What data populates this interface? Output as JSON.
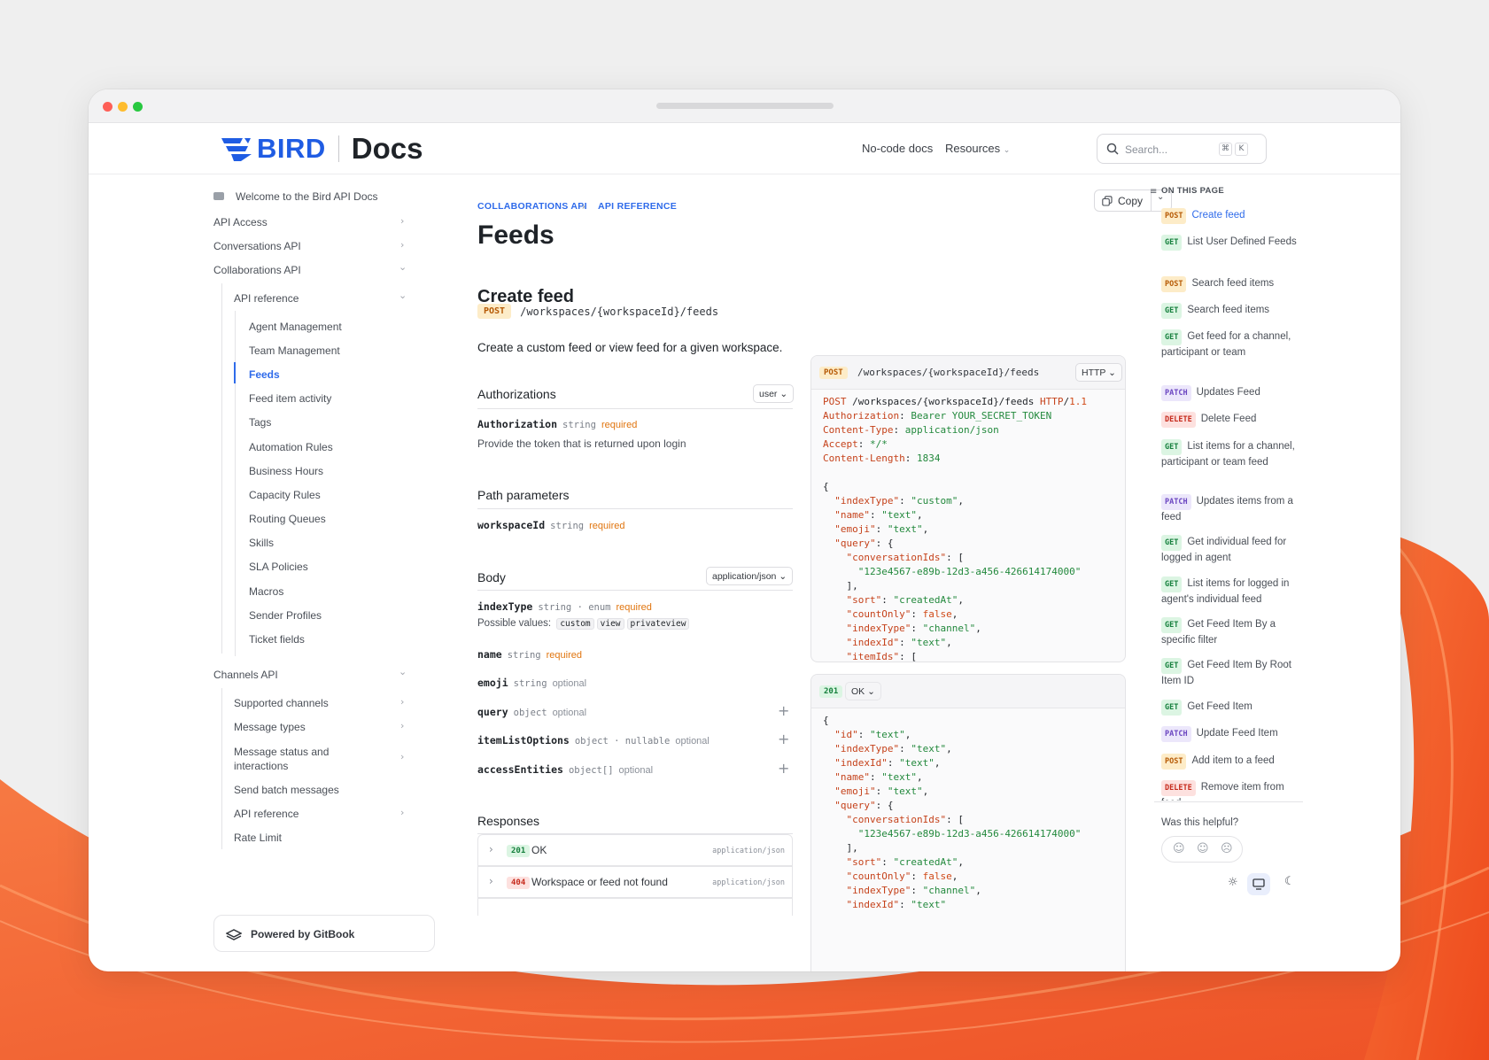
{
  "header": {
    "logo_text": "BIRD",
    "logo_sub": "Docs",
    "nav": [
      "No-code docs",
      "Resources"
    ],
    "search_placeholder": "Search...",
    "shortcut": [
      "⌘",
      "K"
    ]
  },
  "sidebar": {
    "welcome": "Welcome to the Bird API Docs",
    "top": [
      "API Access",
      "Conversations API",
      "Collaborations API"
    ],
    "api_reference": "API reference",
    "collab_items": [
      "Agent Management",
      "Team Management",
      "Feeds",
      "Feed item activity",
      "Tags",
      "Automation Rules",
      "Business Hours",
      "Capacity Rules",
      "Routing Queues",
      "Skills",
      "SLA Policies",
      "Macros",
      "Sender Profiles",
      "Ticket fields"
    ],
    "active_item": "Feeds",
    "channels": "Channels API",
    "channel_items": [
      "Supported channels",
      "Message types",
      "Message status and interactions",
      "Send batch messages",
      "API reference",
      "Rate Limit"
    ],
    "powered_by": "Powered by GitBook"
  },
  "main": {
    "breadcrumb": [
      "COLLABORATIONS API",
      "API REFERENCE"
    ],
    "title": "Feeds",
    "copy_label": "Copy",
    "section_title": "Create feed",
    "method": "POST",
    "path": "/workspaces/{workspaceId}/feeds",
    "description": "Create a custom feed or view feed for a given workspace.",
    "authorizations": {
      "heading": "Authorizations",
      "select": "user",
      "param": "Authorization",
      "type": "string",
      "flag": "required",
      "desc": "Provide the token that is returned upon login"
    },
    "path_params": {
      "heading": "Path parameters",
      "param": "workspaceId",
      "type": "string",
      "flag": "required"
    },
    "body": {
      "heading": "Body",
      "select": "application/json",
      "params": [
        {
          "name": "indexType",
          "type": "string · enum",
          "flag": "required"
        },
        {
          "name": "name",
          "type": "string",
          "flag": "required"
        },
        {
          "name": "emoji",
          "type": "string",
          "flag": "optional"
        },
        {
          "name": "query",
          "type": "object",
          "flag": "optional"
        },
        {
          "name": "itemListOptions",
          "type": "object · nullable",
          "flag": "optional"
        },
        {
          "name": "accessEntities",
          "type": "object[]",
          "flag": "optional"
        }
      ],
      "possible_values_label": "Possible values:",
      "possible_values": [
        "custom",
        "view",
        "privateview"
      ]
    },
    "responses": {
      "heading": "Responses",
      "items": [
        {
          "code": "201",
          "label": "OK",
          "type": "application/json"
        },
        {
          "code": "404",
          "label": "Workspace or feed not found",
          "type": "application/json"
        }
      ]
    }
  },
  "request_panel": {
    "method": "POST",
    "path": "/workspaces/{workspaceId}/feeds",
    "format": "HTTP"
  },
  "response_panel": {
    "code": "201",
    "label": "OK"
  },
  "toc": {
    "title": "ON THIS PAGE",
    "items": [
      {
        "method": "POST",
        "label": "Create feed",
        "active": true
      },
      {
        "method": "GET",
        "label": "List User Defined Feeds"
      },
      {
        "method": "POST",
        "label": "Search feed items"
      },
      {
        "method": "GET",
        "label": "Search feed items"
      },
      {
        "method": "GET",
        "label": "Get feed for a channel, participant or team"
      },
      {
        "method": "PATCH",
        "label": "Updates Feed"
      },
      {
        "method": "DELETE",
        "label": "Delete Feed"
      },
      {
        "method": "GET",
        "label": "List items for a channel, participant or team feed"
      },
      {
        "method": "PATCH",
        "label": "Updates items from a feed"
      },
      {
        "method": "GET",
        "label": "Get individual feed for logged in agent"
      },
      {
        "method": "GET",
        "label": "List items for logged in agent's individual feed"
      },
      {
        "method": "GET",
        "label": "Get Feed Item By a specific filter"
      },
      {
        "method": "GET",
        "label": "Get Feed Item By Root Item ID"
      },
      {
        "method": "GET",
        "label": "Get Feed Item"
      },
      {
        "method": "PATCH",
        "label": "Update Feed Item"
      },
      {
        "method": "POST",
        "label": "Add item to a feed"
      },
      {
        "method": "DELETE",
        "label": "Remove item from feed"
      }
    ],
    "helpful": "Was this helpful?"
  },
  "colors": {
    "accent": "#1f5ce3",
    "link": "#2f6bea",
    "required": "#e0750f",
    "background_art": "#f2592a"
  }
}
